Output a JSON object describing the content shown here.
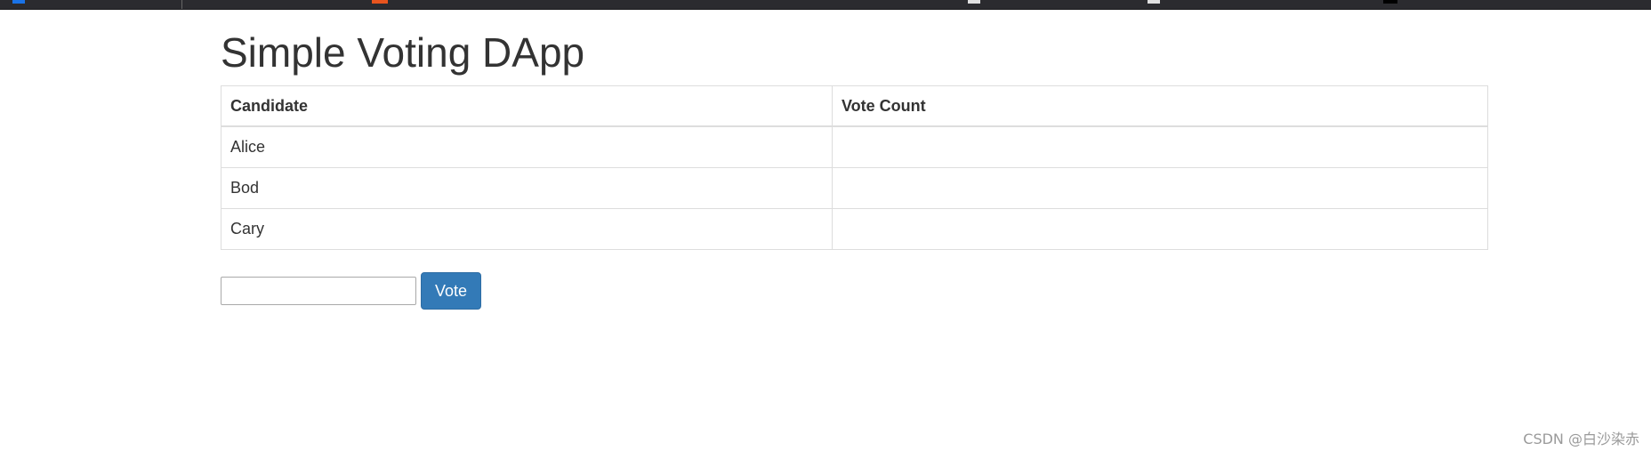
{
  "page": {
    "title": "Simple Voting DApp"
  },
  "table": {
    "headers": [
      "Candidate",
      "Vote Count"
    ],
    "rows": [
      {
        "candidate": "Alice",
        "votes": ""
      },
      {
        "candidate": "Bod",
        "votes": ""
      },
      {
        "candidate": "Cary",
        "votes": ""
      }
    ]
  },
  "form": {
    "input_value": "",
    "vote_label": "Vote"
  },
  "watermark": "CSDN @白沙染赤",
  "colors": {
    "button_bg": "#337ab7",
    "table_border": "#dddddd",
    "browser_bar": "#2b2b2f"
  }
}
